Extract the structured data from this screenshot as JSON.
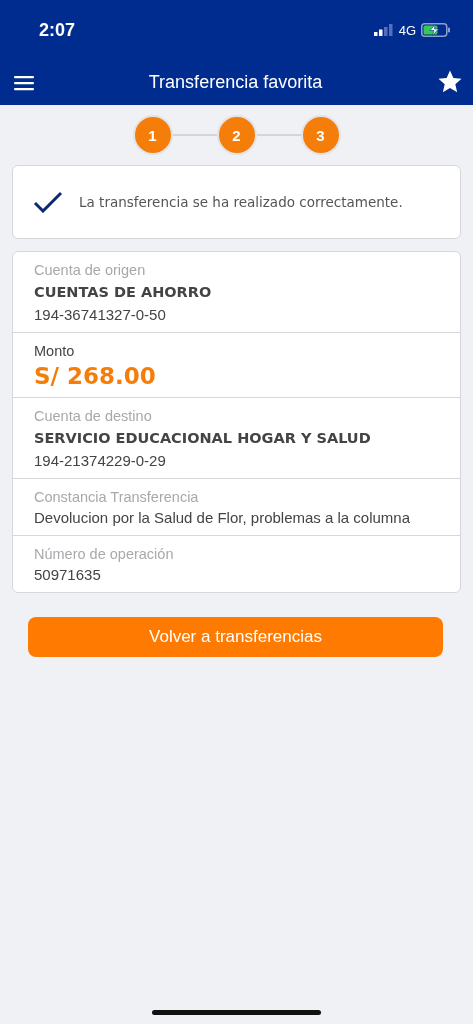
{
  "status_bar": {
    "time": "2:07",
    "network": "4G"
  },
  "nav": {
    "title": "Transferencia favorita"
  },
  "steps": [
    "1",
    "2",
    "3"
  ],
  "message": "La transferencia se ha realizado correctamente.",
  "details": [
    {
      "kind": "account",
      "label": "Cuenta de origen",
      "name": "CUENTAS DE AHORRO",
      "number": "194-36741327-0-50"
    },
    {
      "kind": "amount",
      "label": "Monto",
      "value": "S/ 268.00"
    },
    {
      "kind": "account",
      "label": "Cuenta de destino",
      "name": "SERVICIO EDUCACIONAL HOGAR Y SALUD",
      "number": "194-21374229-0-29"
    },
    {
      "kind": "text",
      "label": "Constancia Transferencia",
      "value": "Devolucion por la Salud de Flor, problemas a la columna"
    },
    {
      "kind": "text",
      "label": "Número de operación",
      "value": "50971635"
    }
  ],
  "button": "Volver a transferencias"
}
